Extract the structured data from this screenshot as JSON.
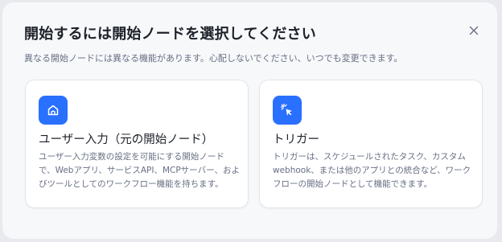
{
  "dialog": {
    "title": "開始するには開始ノードを選択してください",
    "subtitle": "異なる開始ノードには異なる機能があります。心配しないでください、いつでも変更できます。",
    "close_icon": "close-icon"
  },
  "cards": [
    {
      "icon": "home-icon",
      "title": "ユーザー入力（元の開始ノード）",
      "description": "ユーザー入力変数の設定を可能にする開始ノードで、Webアプリ、サービスAPI、MCPサーバー、およびツールとしてのワークフロー機能を持ちます。"
    },
    {
      "icon": "cursor-click-icon",
      "title": "トリガー",
      "description": "トリガーは、スケジュールされたタスク、カスタムwebhook、または他のアプリとの統合など、ワークフローの開始ノードとして機能できます。"
    }
  ],
  "colors": {
    "accent": "#2970ff",
    "title_text": "#1d2129",
    "muted_text": "#676f83",
    "card_border": "#e4e6eb"
  }
}
